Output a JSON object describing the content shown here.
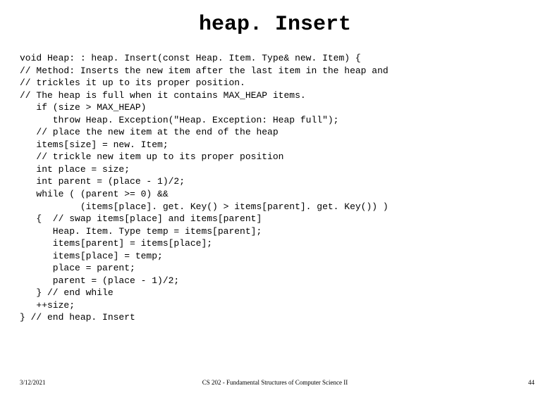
{
  "title": "heap. Insert",
  "code": "void Heap: : heap. Insert(const Heap. Item. Type& new. Item) {\n// Method: Inserts the new item after the last item in the heap and\n// trickles it up to its proper position.\n// The heap is full when it contains MAX_HEAP items.\n   if (size > MAX_HEAP)\n      throw Heap. Exception(\"Heap. Exception: Heap full\");\n   // place the new item at the end of the heap\n   items[size] = new. Item;\n   // trickle new item up to its proper position\n   int place = size;\n   int parent = (place - 1)/2;\n   while ( (parent >= 0) &&\n           (items[place]. get. Key() > items[parent]. get. Key()) )\n   {  // swap items[place] and items[parent]\n      Heap. Item. Type temp = items[parent];\n      items[parent] = items[place];\n      items[place] = temp;\n      place = parent;\n      parent = (place - 1)/2;\n   } // end while\n   ++size;\n} // end heap. Insert",
  "footer": {
    "date": "3/12/2021",
    "center": "CS 202 - Fundamental Structures of Computer Science II",
    "page": "44"
  }
}
